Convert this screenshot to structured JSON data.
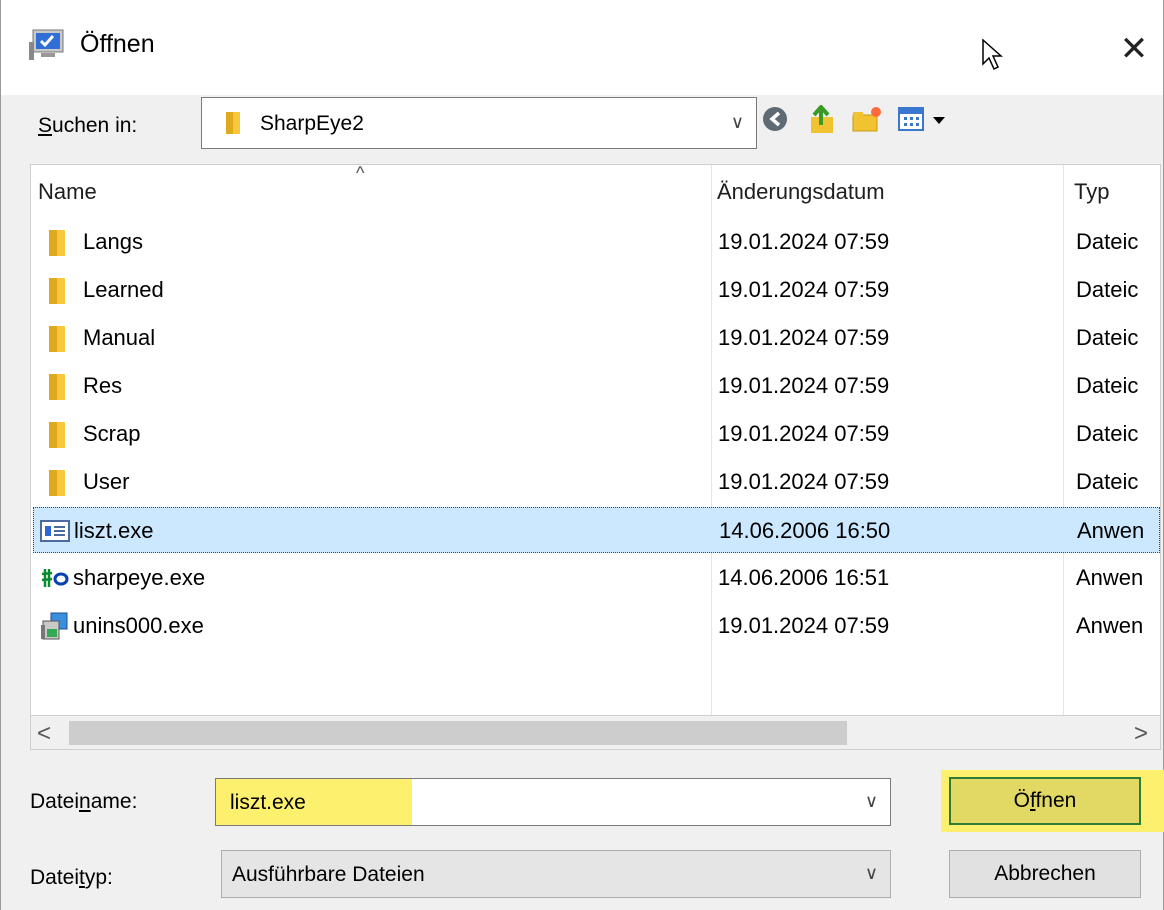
{
  "window": {
    "title": "Öffnen",
    "close_glyph": "✕"
  },
  "look_in": {
    "label_prefix": "",
    "label_u": "S",
    "label_rest": "uchen in:",
    "value": "SharpEye2",
    "dropdown_glyph": "∨"
  },
  "columns": {
    "name": "Name",
    "date": "Änderungsdatum",
    "type": "Typ",
    "sort_glyph": "^"
  },
  "rows": [
    {
      "name": "Langs",
      "date": "19.01.2024 07:59",
      "type": "Dateic",
      "icon": "folder-icon"
    },
    {
      "name": "Learned",
      "date": "19.01.2024 07:59",
      "type": "Dateic",
      "icon": "folder-icon"
    },
    {
      "name": "Manual",
      "date": "19.01.2024 07:59",
      "type": "Dateic",
      "icon": "folder-icon"
    },
    {
      "name": "Res",
      "date": "19.01.2024 07:59",
      "type": "Dateic",
      "icon": "folder-icon"
    },
    {
      "name": "Scrap",
      "date": "19.01.2024 07:59",
      "type": "Dateic",
      "icon": "folder-icon"
    },
    {
      "name": "User",
      "date": "19.01.2024 07:59",
      "type": "Dateic",
      "icon": "folder-icon"
    },
    {
      "name": "liszt.exe",
      "date": "14.06.2006 16:50",
      "type": "Anwen",
      "icon": "app-window-icon",
      "selected": true
    },
    {
      "name": "sharpeye.exe",
      "date": "14.06.2006 16:51",
      "type": "Anwen",
      "icon": "sharpeye-icon"
    },
    {
      "name": "unins000.exe",
      "date": "19.01.2024 07:59",
      "type": "Anwen",
      "icon": "uninstaller-icon"
    }
  ],
  "scroll": {
    "left_glyph": "<",
    "right_glyph": ">"
  },
  "file_name": {
    "label_prefix": "Datei",
    "label_u": "n",
    "label_rest": "ame:",
    "value": "liszt.exe",
    "dropdown_glyph": "∨"
  },
  "file_type": {
    "label_prefix": "Datei",
    "label_u": "t",
    "label_rest": "yp:",
    "value": "Ausführbare Dateien",
    "dropdown_glyph": "∨"
  },
  "buttons": {
    "open_prefix": "Ö",
    "open_u": "f",
    "open_rest": "fnen",
    "cancel": "Abbrechen"
  },
  "colors": {
    "highlight": "#fdf06f",
    "selection": "#cce8ff",
    "focus_border": "#2e7d32",
    "folder": "#f8c73e"
  }
}
